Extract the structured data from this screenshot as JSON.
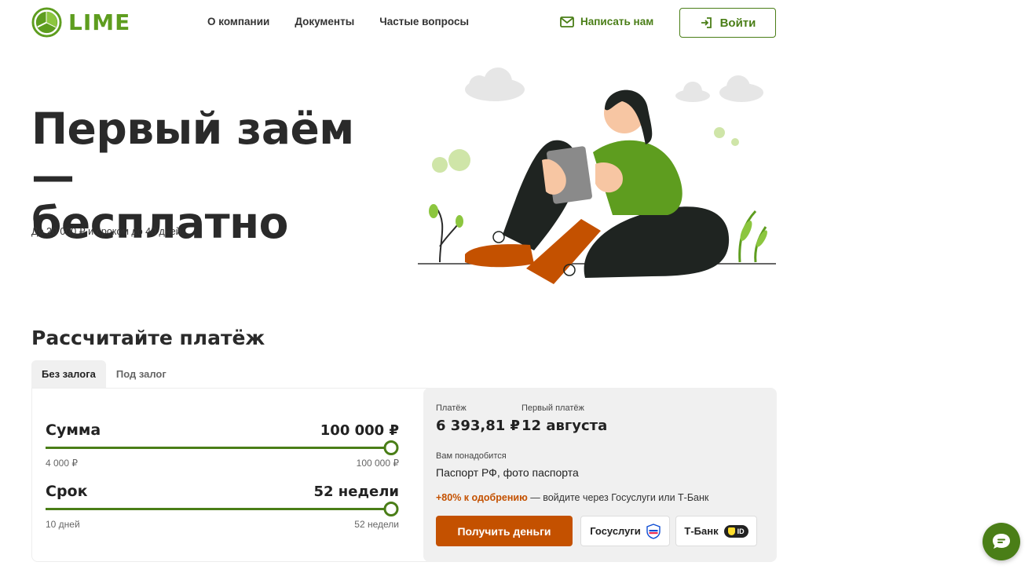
{
  "brand": {
    "name": "LIME",
    "color": "#5e9d1f",
    "accent": "#4a7e17",
    "cta": "#c45100"
  },
  "nav": {
    "items": [
      "О компании",
      "Документы",
      "Частые вопросы"
    ]
  },
  "header": {
    "write_us": "Написать нам",
    "login": "Войти"
  },
  "hero": {
    "title_line1": "Первый заём —",
    "title_line2": "бесплатно",
    "subtitle": "До 20 000 ₽ и сроком до 40 дней"
  },
  "calculator": {
    "title": "Рассчитайте платёж",
    "tabs": [
      "Без залога",
      "Под залог"
    ],
    "active_tab": 0,
    "amount": {
      "label": "Сумма",
      "value": "100 000 ₽",
      "min": "4 000 ₽",
      "max": "100 000 ₽",
      "position_pct": 100
    },
    "term": {
      "label": "Срок",
      "value": "52 недели",
      "min": "10 дней",
      "max": "52 недели",
      "position_pct": 100
    },
    "payment": {
      "label": "Платёж",
      "value": "6 393,81 ₽"
    },
    "first_payment": {
      "label": "Первый платёж",
      "value": "12 августа"
    },
    "need": {
      "label": "Вам понадобится",
      "value": "Паспорт РФ, фото паспорта"
    },
    "approval": {
      "accent": "+80% к одобрению",
      "rest": " — войдите через Госуслуги или Т-Банк"
    },
    "buttons": {
      "get_money": "Получить деньги",
      "gosuslugi": "Госуслуги",
      "tbank": "Т-Банк",
      "tbank_id": "ID"
    }
  },
  "icons": {
    "mail": "mail-icon",
    "login": "login-arrow-icon",
    "chat": "chat-icon",
    "gosuslugi": "gosuslugi-icon",
    "tbank": "tbank-id-icon"
  }
}
